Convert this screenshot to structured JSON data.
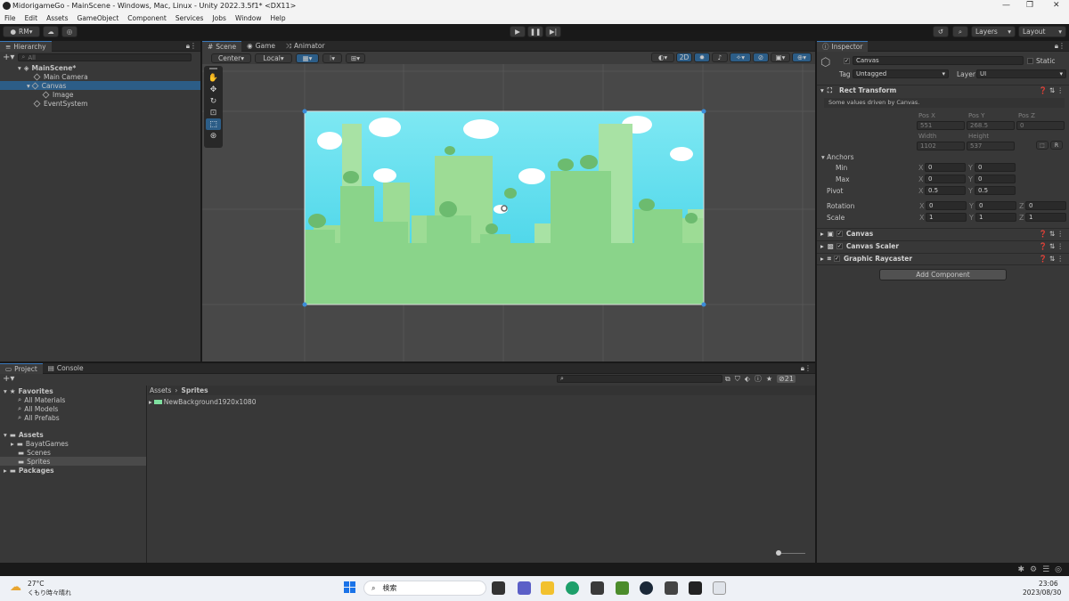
{
  "window": {
    "title": "MidorigameGo - MainScene - Windows, Mac, Linux - Unity 2022.3.5f1* <DX11>"
  },
  "menu": [
    "File",
    "Edit",
    "Assets",
    "GameObject",
    "Component",
    "Services",
    "Jobs",
    "Window",
    "Help"
  ],
  "toolbar": {
    "account": "RM",
    "layers": "Layers",
    "layout": "Layout"
  },
  "hierarchy": {
    "tab": "Hierarchy",
    "search_placeholder": "All",
    "scene": "MainScene*",
    "items": [
      {
        "label": "Main Camera",
        "indent": 1
      },
      {
        "label": "Canvas",
        "indent": 1,
        "selected": true
      },
      {
        "label": "Image",
        "indent": 2
      },
      {
        "label": "EventSystem",
        "indent": 1
      }
    ]
  },
  "scene_view": {
    "tabs": [
      "Scene",
      "Game",
      "Animator"
    ],
    "pivot": "Center",
    "space": "Local",
    "mode_2d": "2D"
  },
  "inspector": {
    "tab": "Inspector",
    "object_name": "Canvas",
    "static_label": "Static",
    "tag_label": "Tag",
    "tag_value": "Untagged",
    "layer_label": "Layer",
    "layer_value": "UI",
    "rect_transform": {
      "title": "Rect Transform",
      "note": "Some values driven by Canvas.",
      "pos_x_label": "Pos X",
      "pos_y_label": "Pos Y",
      "pos_z_label": "Pos Z",
      "pos_x": "551",
      "pos_y": "268.5",
      "pos_z": "0",
      "width_label": "Width",
      "height_label": "Height",
      "width": "1102",
      "height": "537",
      "anchors_label": "Anchors",
      "min_label": "Min",
      "max_label": "Max",
      "min_x": "0",
      "min_y": "0",
      "max_x": "0",
      "max_y": "0",
      "pivot_label": "Pivot",
      "pivot_x": "0.5",
      "pivot_y": "0.5",
      "rotation_label": "Rotation",
      "rot_x": "0",
      "rot_y": "0",
      "rot_z": "0",
      "scale_label": "Scale",
      "scale_x": "1",
      "scale_y": "1",
      "scale_z": "1",
      "x": "X",
      "y": "Y",
      "z": "Z"
    },
    "components": [
      "Canvas",
      "Canvas Scaler",
      "Graphic Raycaster"
    ],
    "add_component": "Add Component"
  },
  "project": {
    "tabs": [
      "Project",
      "Console"
    ],
    "favorites_label": "Favorites",
    "favorites": [
      "All Materials",
      "All Models",
      "All Prefabs"
    ],
    "assets_label": "Assets",
    "folders": [
      "BayatGames",
      "Scenes",
      "Sprites"
    ],
    "packages_label": "Packages",
    "breadcrumb_root": "Assets",
    "breadcrumb_leaf": "Sprites",
    "files": [
      "NewBackground1920x1080"
    ],
    "hidden_count": "21"
  },
  "taskbar": {
    "weather_temp": "27°C",
    "weather_desc": "くもり時々晴れ",
    "search_placeholder": "検索",
    "time": "23:06",
    "date": "2023/08/30"
  },
  "colors": {
    "accent": "#2c5d87",
    "sky": "#6fe0ee",
    "ground": "#8ad48a"
  }
}
